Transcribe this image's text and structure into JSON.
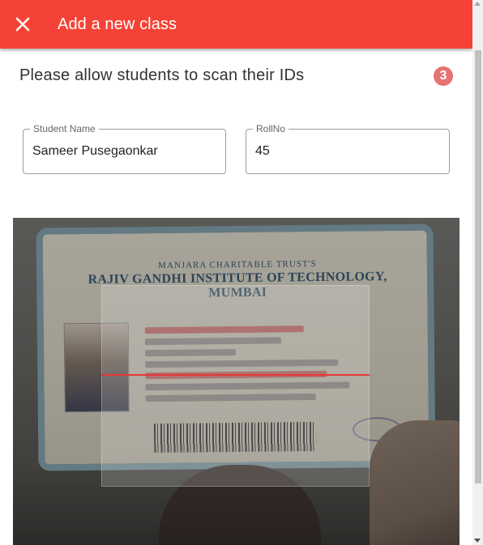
{
  "header": {
    "title": "Add a new class",
    "close_icon": "close-icon"
  },
  "instructions": {
    "text": "Please allow students to scan their IDs",
    "step_number": "3"
  },
  "form": {
    "student_name": {
      "label": "Student Name",
      "value": "Sameer Pusegaonkar"
    },
    "roll_no": {
      "label": "RollNo",
      "value": "45"
    }
  },
  "camera": {
    "card_trust": "MANJARA CHARITABLE TRUST'S",
    "card_institute": "RAJIV GANDHI INSTITUTE OF TECHNOLOGY, MUMBAI"
  },
  "colors": {
    "appbar": "#f44336",
    "badge": "#e57373",
    "scan_line": "#e53935"
  }
}
